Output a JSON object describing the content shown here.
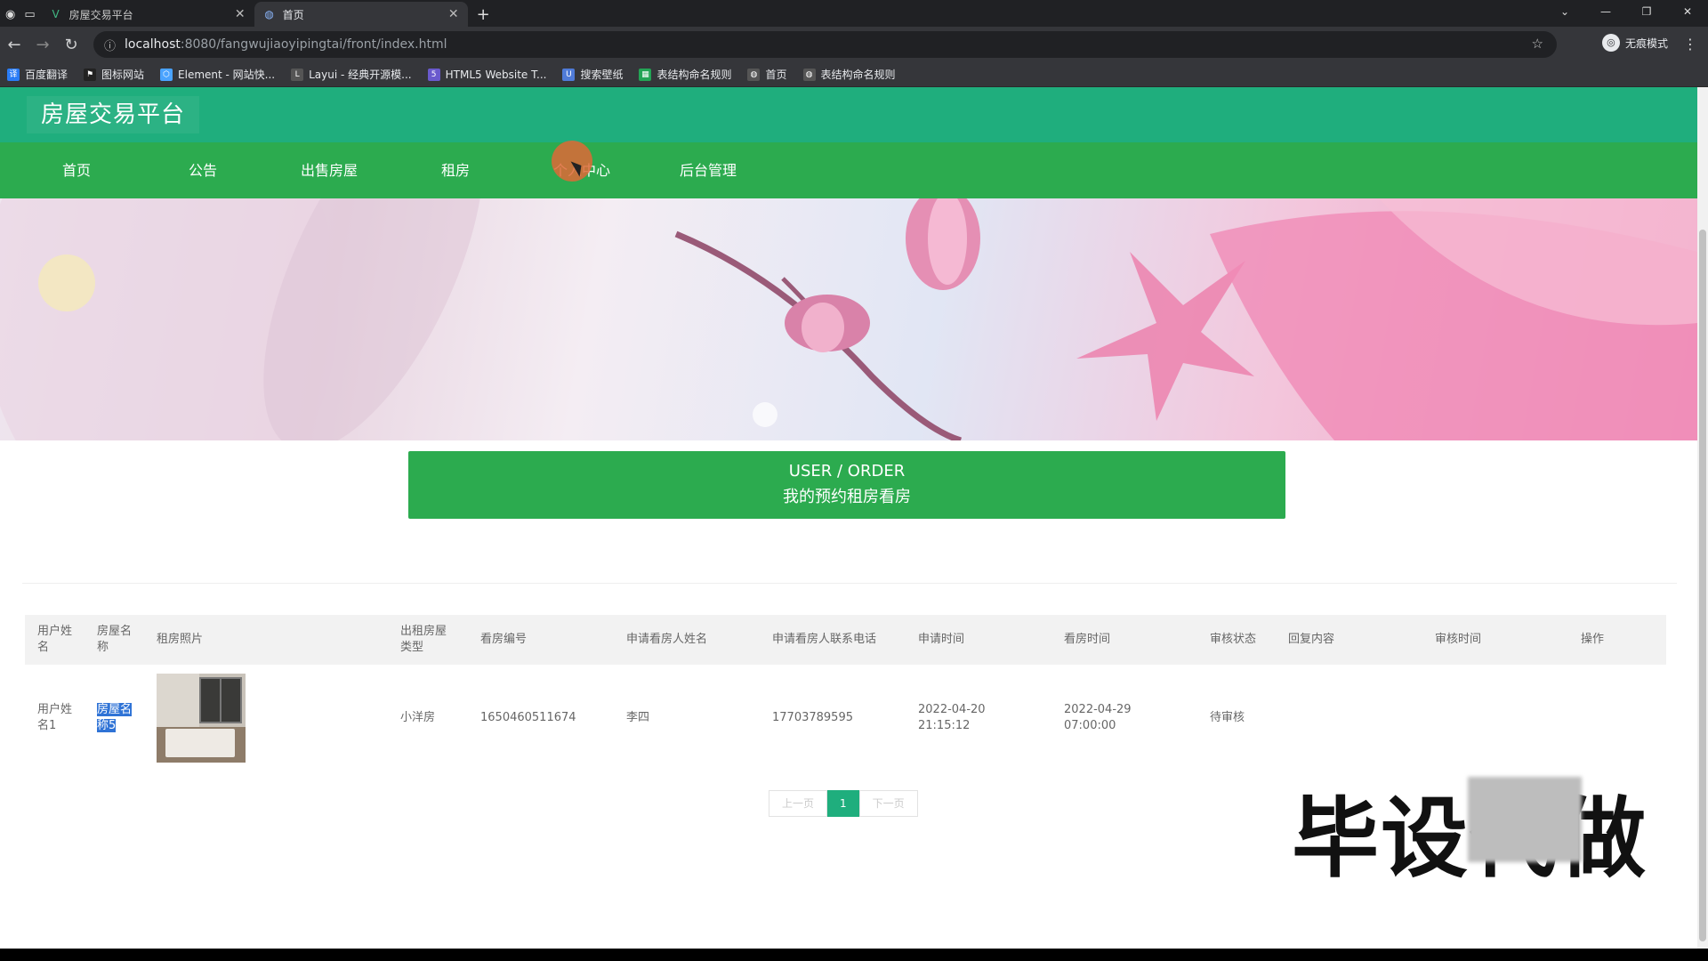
{
  "browser": {
    "tabs": [
      {
        "title": "房屋交易平台",
        "icon": "vue-icon"
      },
      {
        "title": "首页",
        "icon": "globe-icon"
      }
    ],
    "new_tab": "+",
    "url_host": "localhost",
    "url_path": ":8080/fangwujiaoyipingtai/front/index.html",
    "incognito_label": "无痕模式",
    "bookmarks": [
      {
        "label": "百度翻译",
        "icon": "translate-icon",
        "color": "#2a7cf6"
      },
      {
        "label": "图标网站",
        "icon": "flag-icon",
        "color": "#222222"
      },
      {
        "label": "Element - 网站快...",
        "icon": "element-icon",
        "color": "#4aa3ff"
      },
      {
        "label": "Layui - 经典开源模...",
        "icon": "layui-icon",
        "color": "#555555"
      },
      {
        "label": "HTML5 Website T...",
        "icon": "html5-icon",
        "color": "#6a5acd"
      },
      {
        "label": "搜索壁纸",
        "icon": "wallpaper-icon",
        "color": "#4f7bd8"
      },
      {
        "label": "表结构命名规则",
        "icon": "sheet-icon",
        "color": "#23a455"
      },
      {
        "label": "首页",
        "icon": "globe-icon",
        "color": "#555555"
      },
      {
        "label": "表结构命名规则",
        "icon": "globe-icon",
        "color": "#555555"
      }
    ]
  },
  "site": {
    "title": "房屋交易平台",
    "nav": [
      "首页",
      "公告",
      "出售房屋",
      "租房",
      "个人中心",
      "后台管理"
    ],
    "section_title_en": "USER / ORDER",
    "section_title_cn": "我的预约租房看房"
  },
  "table": {
    "headers": [
      "用户姓名",
      "房屋名称",
      "租房照片",
      "出租房屋类型",
      "看房编号",
      "申请看房人姓名",
      "申请看房人联系电话",
      "申请时间",
      "看房时间",
      "审核状态",
      "回复内容",
      "审核时间",
      "操作"
    ],
    "rows": [
      {
        "user": "用户姓名1",
        "house_name": "房屋名称5",
        "type": "小洋房",
        "number": "1650460511674",
        "applicant": "李四",
        "phone": "17703789595",
        "apply_time": "2022-04-20 21:15:12",
        "view_time": "2022-04-29 07:00:00",
        "status": "待审核",
        "reply": "",
        "review_time": "",
        "action": ""
      }
    ]
  },
  "pagination": {
    "prev": "上一页",
    "current": "1",
    "next": "下一页"
  },
  "watermark": "毕设代做",
  "colors": {
    "header": "#1fae7d",
    "nav": "#2cab4f"
  }
}
